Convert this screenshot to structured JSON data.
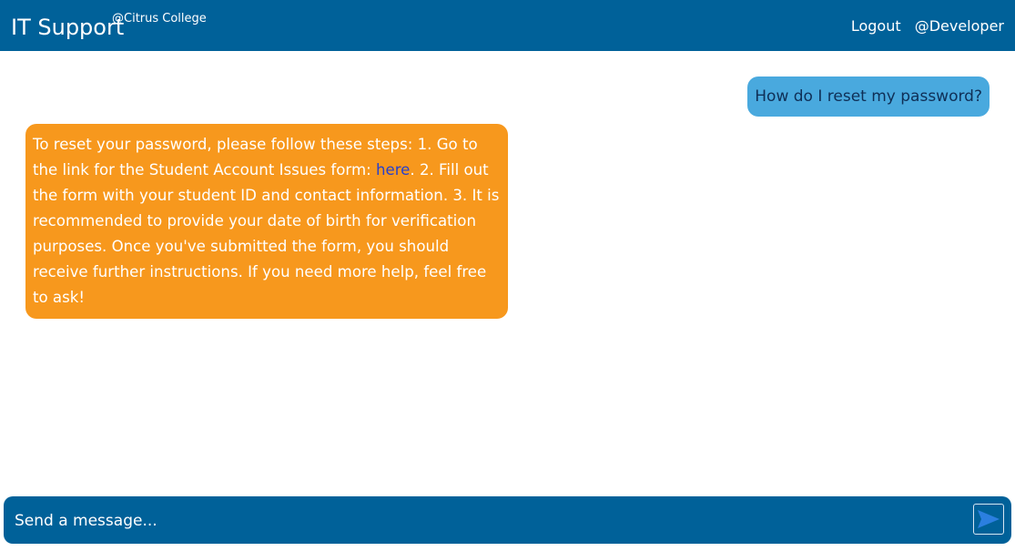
{
  "header": {
    "title": "IT Support",
    "subtitle": "@Citrus College",
    "logout_label": "Logout",
    "user_label": "@Developer"
  },
  "messages": [
    {
      "role": "user",
      "text": "How do I reset my password?"
    },
    {
      "role": "assistant",
      "text_before_link": "To reset your password, please follow these steps: 1. Go to the link for the Student Account Issues form: ",
      "link_text": "here",
      "text_after_link": ". 2. Fill out the form with your student ID and contact information. 3. It is recommended to provide your date of birth for verification purposes. Once you've submitted the form, you should receive further instructions. If you need more help, feel free to ask!"
    }
  ],
  "composer": {
    "placeholder": "Send a message...",
    "value": "",
    "send_icon": "send-arrow-icon"
  },
  "colors": {
    "header_bg": "#006199",
    "user_bubble": "#49a9de",
    "bot_bubble": "#f7981d",
    "link": "#2840cc",
    "send_icon": "#2b7fe0"
  }
}
